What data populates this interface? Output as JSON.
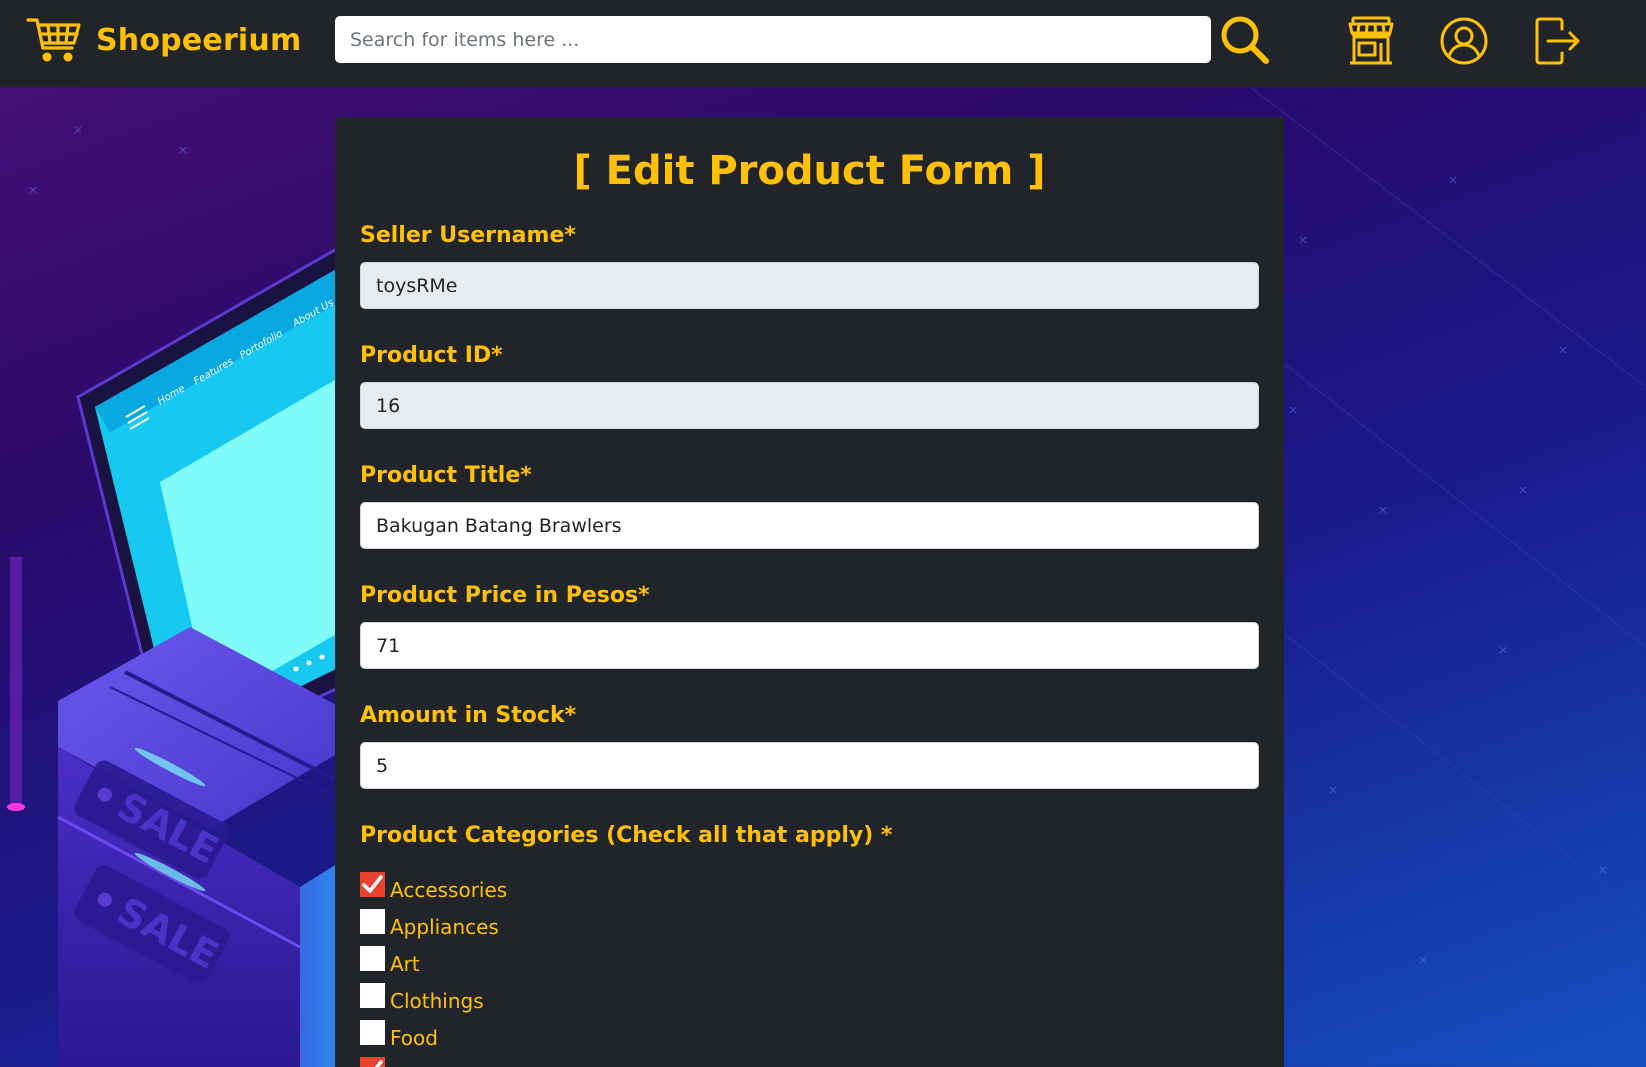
{
  "app": {
    "brand_name": "Shopeerium",
    "accent_color": "#ffc107",
    "navbar_color": "#212529"
  },
  "search": {
    "placeholder": "Search for items here ...",
    "value": ""
  },
  "nav_icons": [
    "cart-icon",
    "search-icon",
    "store-icon",
    "profile-icon",
    "logout-icon"
  ],
  "background_art": {
    "screen_nav_items": [
      "Home",
      "Features",
      "Portofolio",
      "About Us"
    ],
    "box_labels": [
      "SALE",
      "SALE"
    ]
  },
  "form": {
    "title": "[ Edit Product Form ]",
    "fields": [
      {
        "label": "Seller Username*",
        "value": "toysRMe",
        "readonly": true
      },
      {
        "label": "Product ID*",
        "value": "16",
        "readonly": true
      },
      {
        "label": "Product Title*",
        "value": "Bakugan Batang Brawlers",
        "readonly": false
      },
      {
        "label": "Product Price in Pesos*",
        "value": "71",
        "readonly": false
      },
      {
        "label": "Amount in Stock*",
        "value": "5",
        "readonly": false
      }
    ],
    "categories_label": "Product Categories (Check all that apply) *",
    "categories": [
      {
        "label": "Accessories",
        "checked": true
      },
      {
        "label": "Appliances",
        "checked": false
      },
      {
        "label": "Art",
        "checked": false
      },
      {
        "label": "Clothings",
        "checked": false
      },
      {
        "label": "Food",
        "checked": false
      },
      {
        "label": "",
        "checked": true
      }
    ],
    "checkbox_checked_color": "#e8432f"
  }
}
